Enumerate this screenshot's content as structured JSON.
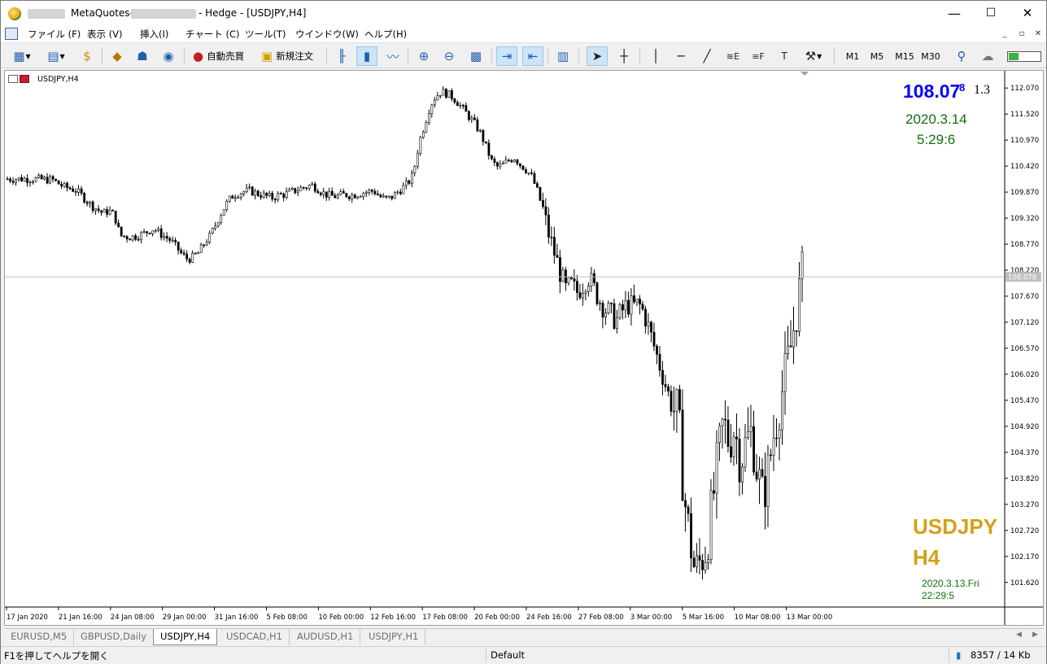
{
  "window": {
    "title_prefix": "MetaQuotes-",
    "title_suffix": "- Hedge - [USDJPY,H4]",
    "minimize": "—",
    "maximize": "☐",
    "close": "✕"
  },
  "menu": {
    "items": [
      "ファイル (F)",
      "表示 (V)",
      "挿入(I)",
      "チャート (C)",
      "ツール(T)",
      "ウインドウ(W)",
      "ヘルプ(H)"
    ],
    "mdi": [
      "_",
      "▫",
      "✕"
    ]
  },
  "toolbar": {
    "auto_trading": "自動売買",
    "new_order": "新規注文",
    "timeframes": [
      "M1",
      "M5",
      "M15",
      "M30"
    ],
    "icons": [
      "new-chart-icon",
      "profiles-icon",
      "market-watch-icon",
      "navigator-icon",
      "data-window-icon",
      "signals-icon",
      "auto-trading-icon",
      "new-order-icon",
      "bar-chart-icon",
      "candlestick-icon",
      "line-chart-icon",
      "zoom-in-icon",
      "zoom-out-icon",
      "tile-windows-icon",
      "auto-scroll-icon",
      "chart-shift-icon",
      "template-icon",
      "cursor-icon",
      "crosshair-icon",
      "vertical-line-icon",
      "horizontal-line-icon",
      "trendline-icon",
      "fibonacci-icon",
      "fibo-fan-icon",
      "text-label-icon",
      "objects-icon",
      "search-icon",
      "chat-icon",
      "signal-strength-icon"
    ]
  },
  "chart": {
    "window_title": "USDJPY,H4",
    "bid_main": "108.07",
    "bid_last_digit": "8",
    "spread": "1.3",
    "server_date": "2020.3.14",
    "server_time": "5:29:6",
    "symbol": "USDJPY",
    "timeframe": "H4",
    "last_bar_date": "2020.3.13.Fri",
    "last_bar_time": "22:29:5",
    "current_price_label": "108.078",
    "colors": {
      "price_blue": "#0000ff",
      "clock_green": "#107010",
      "symbol_gold": "#d4a017",
      "current_price_line": "#c0c0c0"
    }
  },
  "chart_data": {
    "type": "candlestick",
    "title": "USDJPY,H4",
    "ylim": [
      101.1,
      112.4
    ],
    "current_price": 108.078,
    "yticks": [
      "112.070",
      "111.520",
      "110.970",
      "110.420",
      "109.870",
      "109.320",
      "108.770",
      "108.220",
      "107.670",
      "107.120",
      "106.570",
      "106.020",
      "105.470",
      "104.920",
      "104.370",
      "103.820",
      "103.270",
      "102.720",
      "102.170",
      "101.620"
    ],
    "xticks": [
      "17 Jan 2020",
      "21 Jan 16:00",
      "24 Jan 08:00",
      "29 Jan 00:00",
      "31 Jan 16:00",
      "5 Feb 08:00",
      "10 Feb 00:00",
      "12 Feb 16:00",
      "17 Feb 08:00",
      "20 Feb 00:00",
      "24 Feb 16:00",
      "27 Feb 08:00",
      "3 Mar 00:00",
      "5 Mar 16:00",
      "10 Mar 08:00",
      "13 Mar 00:00"
    ],
    "close_path": [
      [
        0,
        110.15
      ],
      [
        2,
        110.15
      ],
      [
        4,
        110.15
      ],
      [
        6,
        110.14
      ],
      [
        8,
        110.13
      ],
      [
        10,
        109.98
      ],
      [
        11,
        109.95
      ],
      [
        12,
        109.92
      ],
      [
        13,
        109.82
      ],
      [
        14,
        109.7
      ],
      [
        15,
        109.58
      ],
      [
        16,
        109.5
      ],
      [
        17,
        109.42
      ],
      [
        18,
        109.48
      ],
      [
        19,
        109.38
      ],
      [
        20,
        108.95
      ],
      [
        21,
        108.93
      ],
      [
        22,
        108.92
      ],
      [
        23,
        108.95
      ],
      [
        24,
        108.98
      ],
      [
        25,
        109.05
      ],
      [
        26,
        109.1
      ],
      [
        27,
        109.0
      ],
      [
        28,
        108.92
      ],
      [
        29,
        108.85
      ],
      [
        30,
        108.7
      ],
      [
        31,
        108.55
      ],
      [
        32,
        108.45
      ],
      [
        33,
        108.5
      ],
      [
        34,
        108.6
      ],
      [
        35,
        108.8
      ],
      [
        36,
        108.95
      ],
      [
        37,
        109.2
      ],
      [
        38,
        109.45
      ],
      [
        39,
        109.65
      ],
      [
        40,
        109.8
      ],
      [
        41,
        109.85
      ],
      [
        42,
        109.88
      ],
      [
        43,
        109.9
      ],
      [
        44,
        109.85
      ],
      [
        45,
        109.82
      ],
      [
        46,
        109.78
      ],
      [
        47,
        109.75
      ],
      [
        48,
        109.8
      ],
      [
        49,
        109.82
      ],
      [
        50,
        109.86
      ],
      [
        51,
        109.9
      ],
      [
        52,
        109.95
      ],
      [
        53,
        109.98
      ],
      [
        54,
        110.02
      ],
      [
        55,
        109.95
      ],
      [
        56,
        109.85
      ],
      [
        57,
        109.8
      ],
      [
        58,
        109.78
      ],
      [
        59,
        109.8
      ],
      [
        60,
        109.82
      ],
      [
        61,
        109.8
      ],
      [
        62,
        109.83
      ],
      [
        63,
        109.86
      ],
      [
        64,
        109.88
      ],
      [
        65,
        109.9
      ],
      [
        66,
        109.78
      ],
      [
        67,
        109.72
      ],
      [
        68,
        109.75
      ],
      [
        69,
        109.85
      ],
      [
        70,
        109.95
      ],
      [
        71,
        110.05
      ],
      [
        72,
        110.25
      ],
      [
        73,
        110.9
      ],
      [
        74,
        111.3
      ],
      [
        75,
        111.7
      ],
      [
        76,
        111.9
      ],
      [
        77,
        112.0
      ],
      [
        78,
        111.95
      ],
      [
        79,
        111.88
      ],
      [
        80,
        111.75
      ],
      [
        81,
        111.6
      ],
      [
        82,
        111.45
      ],
      [
        83,
        111.3
      ],
      [
        84,
        111.1
      ],
      [
        85,
        110.8
      ],
      [
        86,
        110.5
      ],
      [
        87,
        110.4
      ],
      [
        88,
        110.45
      ],
      [
        89,
        110.55
      ],
      [
        90,
        110.6
      ],
      [
        91,
        110.45
      ],
      [
        92,
        110.35
      ],
      [
        93,
        110.2
      ],
      [
        94,
        109.9
      ],
      [
        95,
        109.5
      ],
      [
        96,
        109.0
      ],
      [
        97,
        108.6
      ],
      [
        98,
        108.2
      ],
      [
        99,
        107.8
      ],
      [
        100,
        107.9
      ],
      [
        101,
        107.75
      ],
      [
        102,
        107.9
      ],
      [
        103,
        108.1
      ],
      [
        104,
        107.85
      ],
      [
        105,
        107.6
      ],
      [
        106,
        107.4
      ],
      [
        107,
        107.3
      ],
      [
        108,
        107.15
      ],
      [
        109,
        107.35
      ],
      [
        110,
        107.5
      ],
      [
        111,
        107.45
      ],
      [
        112,
        107.5
      ],
      [
        113,
        107.3
      ],
      [
        114,
        106.9
      ],
      [
        115,
        106.5
      ],
      [
        116,
        106.1
      ],
      [
        117,
        105.7
      ],
      [
        118,
        105.3
      ],
      [
        119,
        105.2
      ],
      [
        120,
        103.5
      ],
      [
        121,
        102.6
      ],
      [
        122,
        101.8
      ],
      [
        123,
        102.1
      ],
      [
        124,
        102.35
      ],
      [
        125,
        103.2
      ],
      [
        126,
        104.2
      ],
      [
        127,
        105.0
      ],
      [
        128,
        104.6
      ],
      [
        129,
        104.9
      ],
      [
        130,
        104.2
      ],
      [
        131,
        104.55
      ],
      [
        132,
        104.8
      ],
      [
        133,
        104.0
      ],
      [
        134,
        103.4
      ],
      [
        135,
        104.0
      ],
      [
        136,
        104.8
      ],
      [
        137,
        105.4
      ],
      [
        138,
        106.0
      ],
      [
        139,
        106.6
      ],
      [
        140,
        107.4
      ],
      [
        141,
        108.1
      ]
    ]
  },
  "tabs": [
    "EURUSD,M5",
    "GBPUSD,Daily",
    "USDJPY,H4",
    "USDCAD,H1",
    "AUDUSD,H1",
    "USDJPY,H1"
  ],
  "status": {
    "help": "F1を押してヘルプを開く",
    "profile": "Default",
    "traffic": "8357 / 14 Kb"
  }
}
